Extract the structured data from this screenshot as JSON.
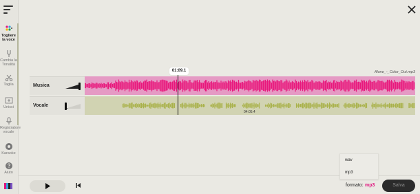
{
  "sidebar": {
    "items": [
      {
        "label": "Togliere la voce",
        "icon": "vocal-remover-icon",
        "active": true
      },
      {
        "label": "Cambia la Tonalità",
        "icon": "tuning-fork-icon"
      },
      {
        "label": "Taglia",
        "icon": "scissors-icon"
      },
      {
        "label": "Unisci",
        "icon": "join-icon"
      },
      {
        "label": "Registratore vocale",
        "icon": "microphone-icon"
      },
      {
        "label": "Karaoke",
        "icon": "karaoke-icon"
      },
      {
        "label": "Aiuto",
        "icon": "help-icon"
      }
    ]
  },
  "editor": {
    "playhead_time": "01:09.1",
    "file_name": "Alone_-_Color_Out.mp3",
    "duration": "04:05.4",
    "tracks": [
      {
        "name": "Musica",
        "volume": 1.0,
        "color": "#e8177c",
        "background": "#e59ac4"
      },
      {
        "name": "Vocale",
        "volume": 0.1,
        "color": "#a9b24a",
        "background": "#d1d3b2"
      }
    ]
  },
  "footer": {
    "format_label": "formato:",
    "format_value": "mp3",
    "format_options": [
      "wav",
      "mp3"
    ],
    "save_label": "Salva"
  },
  "colors": {
    "accent": "#e0157f",
    "save_bg": "#2b2b2b",
    "background": "#eae9e3"
  }
}
